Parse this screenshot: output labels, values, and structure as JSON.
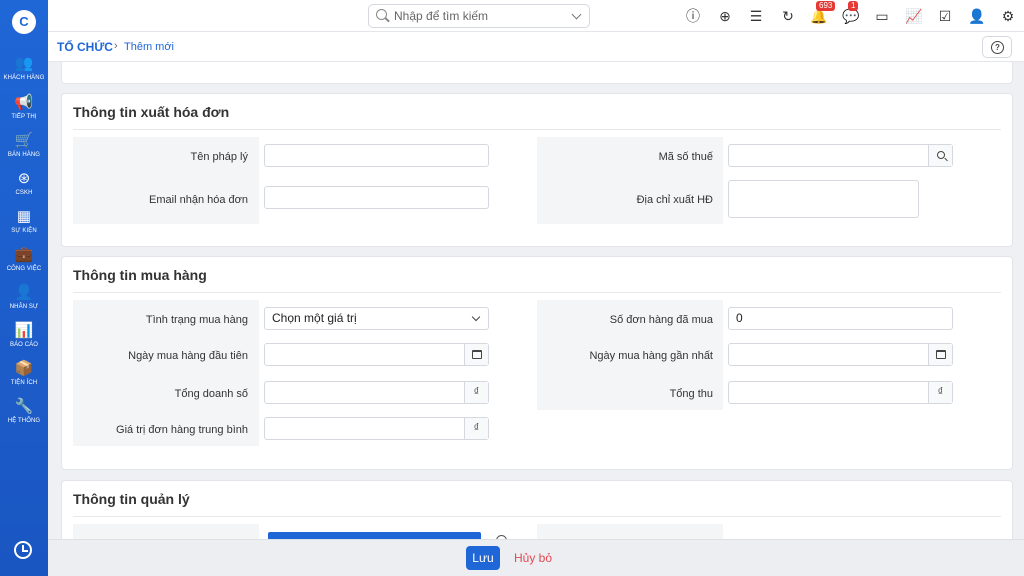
{
  "sidebar": {
    "logo": "C",
    "items": [
      {
        "label": "KHÁCH HÀNG",
        "icon": "users-icon"
      },
      {
        "label": "TIẾP THỊ",
        "icon": "megaphone-icon"
      },
      {
        "label": "BÁN HÀNG",
        "icon": "cart-icon"
      },
      {
        "label": "CSKH",
        "icon": "support-icon"
      },
      {
        "label": "SỰ KIỆN",
        "icon": "calendar-icon"
      },
      {
        "label": "CÔNG VIỆC",
        "icon": "briefcase-icon"
      },
      {
        "label": "NHÂN SỰ",
        "icon": "person-icon"
      },
      {
        "label": "BÁO CÁO",
        "icon": "report-icon"
      },
      {
        "label": "TIỆN ÍCH",
        "icon": "box-icon"
      },
      {
        "label": "HỆ THỐNG",
        "icon": "wrench-icon"
      }
    ]
  },
  "header": {
    "search_placeholder": "Nhập để tìm kiếm",
    "notification_count": "693",
    "message_count": "1"
  },
  "breadcrumb": {
    "root": "TỔ CHỨC",
    "separator": "›",
    "current": "Thêm mới"
  },
  "invoice": {
    "title": "Thông tin xuất hóa đơn",
    "legal_name_label": "Tên pháp lý",
    "legal_name_value": "",
    "tax_code_label": "Mã số thuế",
    "tax_code_value": "",
    "invoice_email_label": "Email nhận hóa đơn",
    "invoice_email_value": "",
    "invoice_address_label": "Địa chỉ xuất HĐ",
    "invoice_address_value": ""
  },
  "purchase": {
    "title": "Thông tin mua hàng",
    "status_label": "Tình trạng mua hàng",
    "status_value": "Chọn một giá trị",
    "orders_label": "Số đơn hàng đã mua",
    "orders_value": "0",
    "first_date_label": "Ngày mua hàng đầu tiên",
    "last_date_label": "Ngày mua hàng gần nhất",
    "total_sales_label": "Tổng doanh số",
    "total_revenue_label": "Tổng thu",
    "avg_order_label": "Giá trị đơn hàng trung bình",
    "currency": "₫"
  },
  "management": {
    "title": "Thông tin quản lý"
  },
  "footer": {
    "save_label": "Lưu",
    "cancel_label": "Hủy bỏ"
  }
}
